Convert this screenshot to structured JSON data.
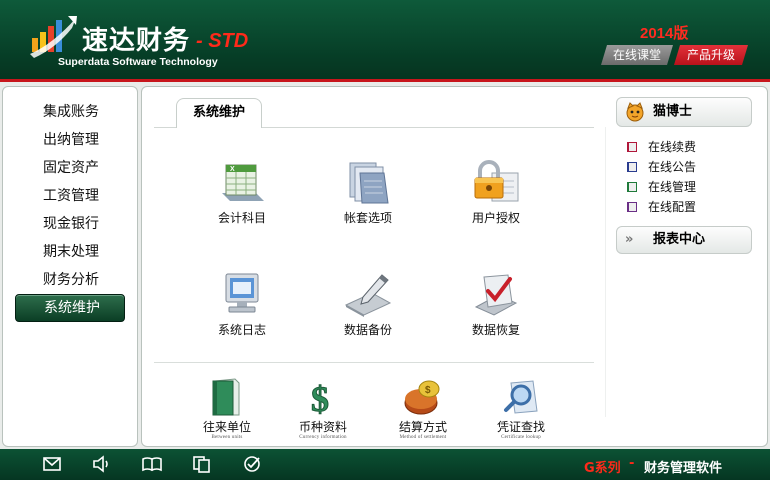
{
  "header": {
    "brand_cn": "速达财务",
    "brand_std": "- STD",
    "brand_en": "Superdata Software Technology",
    "edition": "2014版",
    "online_class": "在线课堂",
    "upgrade": "产品升级"
  },
  "sidebar": {
    "items": [
      {
        "label": "集成账务"
      },
      {
        "label": "出纳管理"
      },
      {
        "label": "固定资产"
      },
      {
        "label": "工资管理"
      },
      {
        "label": "现金银行"
      },
      {
        "label": "期末处理"
      },
      {
        "label": "财务分析"
      },
      {
        "label": "系统维护",
        "active": true
      }
    ]
  },
  "main": {
    "tab": "系统维护",
    "tiles": [
      {
        "label": "会计科目",
        "icon": "spreadsheet-icon"
      },
      {
        "label": "帐套选项",
        "icon": "folder-docs-icon"
      },
      {
        "label": "用户授权",
        "icon": "lock-icon"
      },
      {
        "label": "系统日志",
        "icon": "monitor-icon"
      },
      {
        "label": "数据备份",
        "icon": "pencil-tray-icon"
      },
      {
        "label": "数据恢复",
        "icon": "checkmark-tray-icon"
      }
    ],
    "quick": [
      {
        "label": "往来单位",
        "en": "Between units",
        "icon": "green-book-icon"
      },
      {
        "label": "币种资料",
        "en": "Currency information",
        "icon": "dollar-icon"
      },
      {
        "label": "结算方式",
        "en": "Method of settlement",
        "icon": "coins-icon"
      },
      {
        "label": "凭证查找",
        "en": "Certificate lookup",
        "icon": "magnifier-icon"
      }
    ]
  },
  "right": {
    "expert": "猫博士",
    "links": [
      {
        "label": "在线续费",
        "color": "#b0173a"
      },
      {
        "label": "在线公告",
        "color": "#2a3c8f"
      },
      {
        "label": "在线管理",
        "color": "#1f7a3a"
      },
      {
        "label": "在线配置",
        "color": "#6a2f86"
      }
    ],
    "report": "报表中心",
    "report_chevron": "»"
  },
  "footer": {
    "series": "G系列",
    "dash": "-",
    "product": "财务管理软件",
    "icons": [
      "mail-icon",
      "speaker-icon",
      "book-icon",
      "copy-icon",
      "check-circle-icon"
    ]
  },
  "colors": {
    "header_green": "#0e5a3a",
    "accent_red": "#c7161c",
    "nav_active": "#1f5a3b"
  }
}
